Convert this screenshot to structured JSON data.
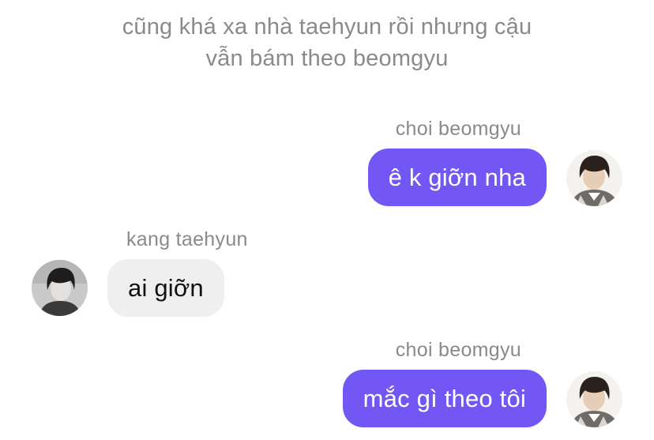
{
  "narration": {
    "line1": "cũng khá xa nhà taehyun rồi nhưng cậu",
    "line2": "vẫn bám theo beomgyu"
  },
  "messages": [
    {
      "sender": "choi beomgyu",
      "text": "ê k giỡn nha",
      "direction": "outgoing"
    },
    {
      "sender": "kang taehyun",
      "text": "ai giỡn",
      "direction": "incoming"
    },
    {
      "sender": "choi beomgyu",
      "text": "mắc gì theo tôi",
      "direction": "outgoing"
    }
  ],
  "colors": {
    "outgoing_bubble": "#7357f5",
    "incoming_bubble": "#efefef",
    "meta_text": "#8a8a8e"
  },
  "icons": {
    "beomgyu_avatar": "profile-photo",
    "taehyun_avatar": "profile-photo"
  }
}
